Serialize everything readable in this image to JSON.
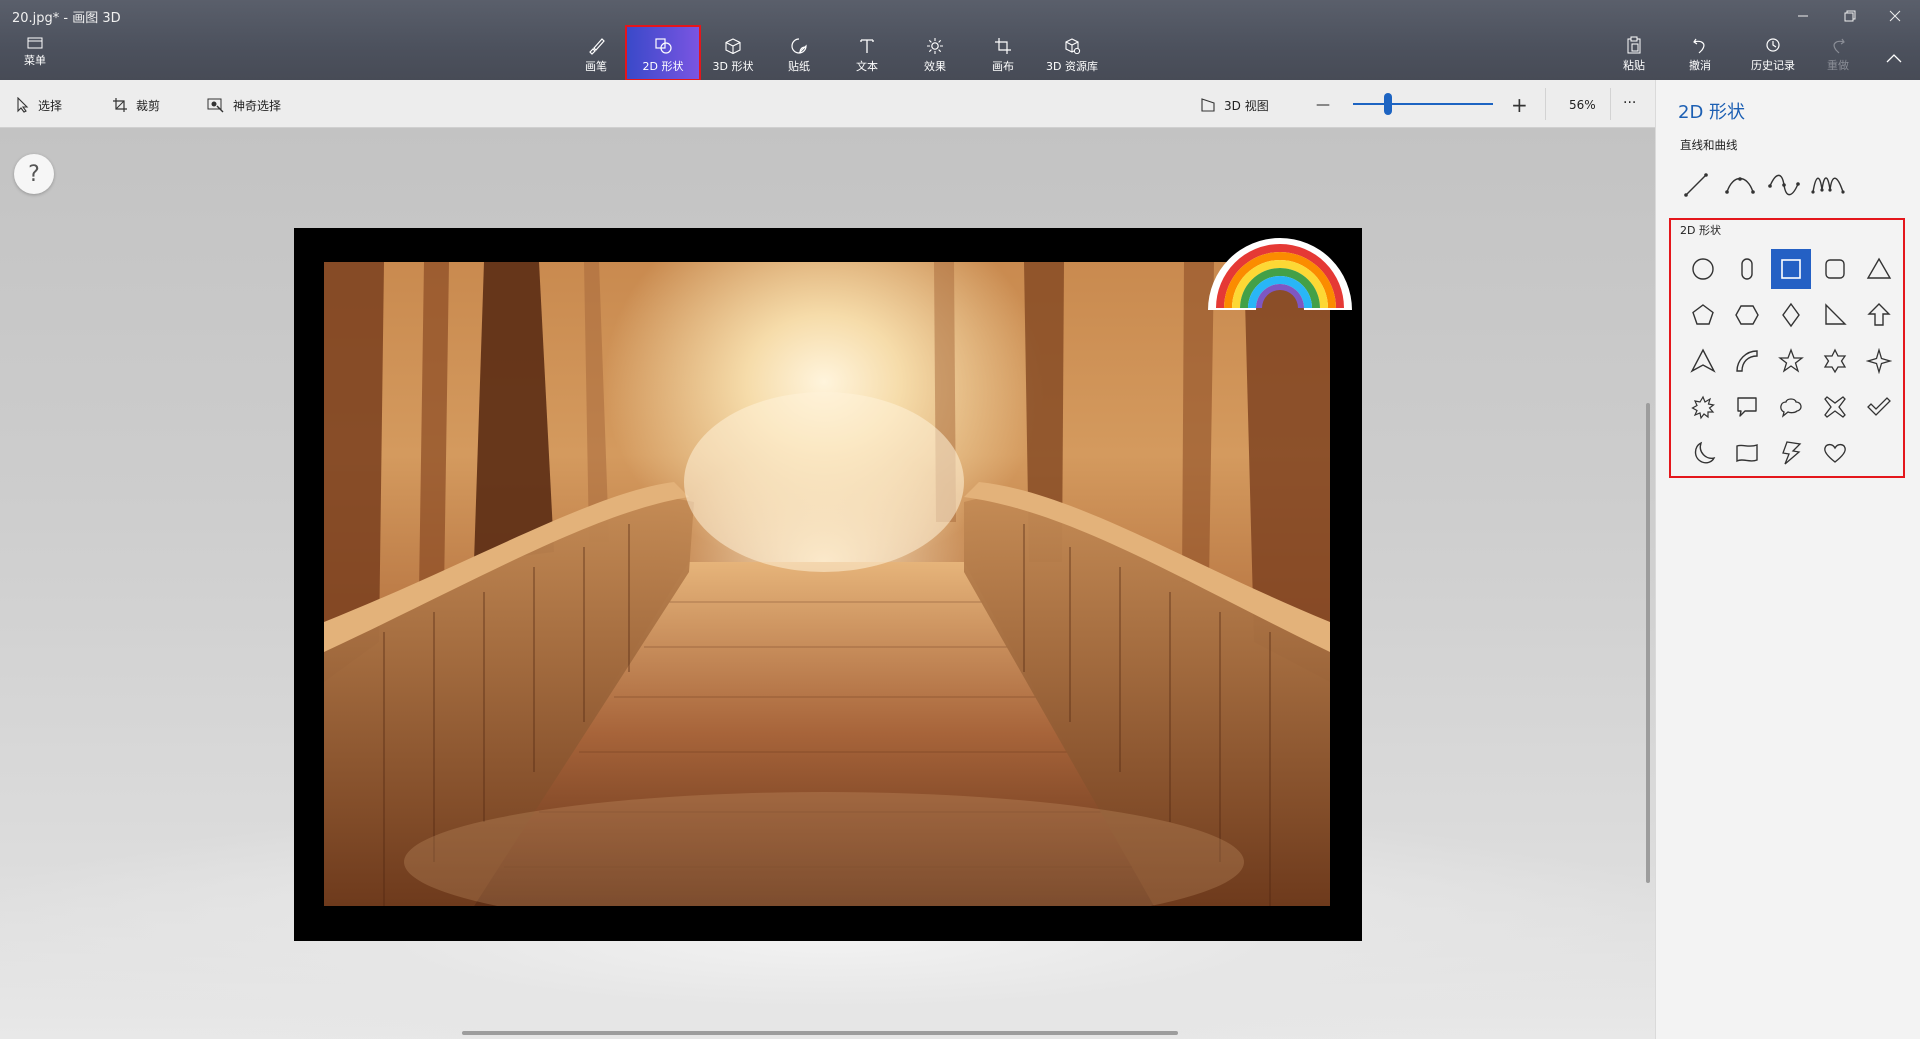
{
  "window": {
    "title": "20.jpg* - 画图 3D",
    "controls": [
      "minimize",
      "restore",
      "close"
    ]
  },
  "ribbon": {
    "menu_label": "菜单",
    "tools": [
      {
        "label": "画笔",
        "icon": "brush-icon",
        "active": false
      },
      {
        "label": "2D 形状",
        "icon": "2d-shapes-icon",
        "active": true
      },
      {
        "label": "3D 形状",
        "icon": "3d-shapes-icon",
        "active": false
      },
      {
        "label": "贴纸",
        "icon": "sticker-icon",
        "active": false
      },
      {
        "label": "文本",
        "icon": "text-icon",
        "active": false
      },
      {
        "label": "效果",
        "icon": "effects-icon",
        "active": false
      },
      {
        "label": "画布",
        "icon": "canvas-icon",
        "active": false
      },
      {
        "label": "3D 资源库",
        "icon": "3d-library-icon",
        "active": false
      }
    ],
    "right_tools": [
      {
        "label": "粘贴",
        "icon": "paste-icon",
        "enabled": true
      },
      {
        "label": "撤消",
        "icon": "undo-icon",
        "enabled": true
      },
      {
        "label": "历史记录",
        "icon": "history-icon",
        "enabled": true
      },
      {
        "label": "重做",
        "icon": "redo-icon",
        "enabled": false
      }
    ]
  },
  "subbar": {
    "select_label": "选择",
    "crop_label": "裁剪",
    "magic_select_label": "神奇选择",
    "view3d_label": "3D 视图",
    "zoom_out": "—",
    "zoom_in": "+",
    "zoom_percent": "56%",
    "zoom_fraction": 0.3,
    "more": "···"
  },
  "canvas": {
    "help": "?",
    "sticker": "rainbow-sticker"
  },
  "panel": {
    "title": "2D 形状",
    "lines_label": "直线和曲线",
    "line_tools": [
      "line-icon",
      "curve-icon",
      "s-curve-icon",
      "wave-curve-icon"
    ],
    "shapes_label": "2D 形状",
    "shapes": [
      "circle-icon",
      "rounded-capsule-icon",
      "square-icon",
      "rounded-square-icon",
      "triangle-icon",
      "pentagon-icon",
      "hexagon-icon",
      "diamond-icon",
      "right-triangle-icon",
      "arrow-up-icon",
      "chevron-triangle-icon",
      "quarter-arc-icon",
      "five-point-star-icon",
      "six-point-star-icon",
      "four-point-star-icon",
      "burst-icon",
      "speech-bubble-icon",
      "thought-bubble-icon",
      "cross-icon",
      "checkmark-icon",
      "crescent-moon-icon",
      "banner-icon",
      "lightning-icon",
      "heart-icon"
    ],
    "selected_shape": "square-icon"
  },
  "colors": {
    "accent": "#2460c4",
    "highlight_border": "#e4161b",
    "active_tool": "#5a4fd6"
  }
}
